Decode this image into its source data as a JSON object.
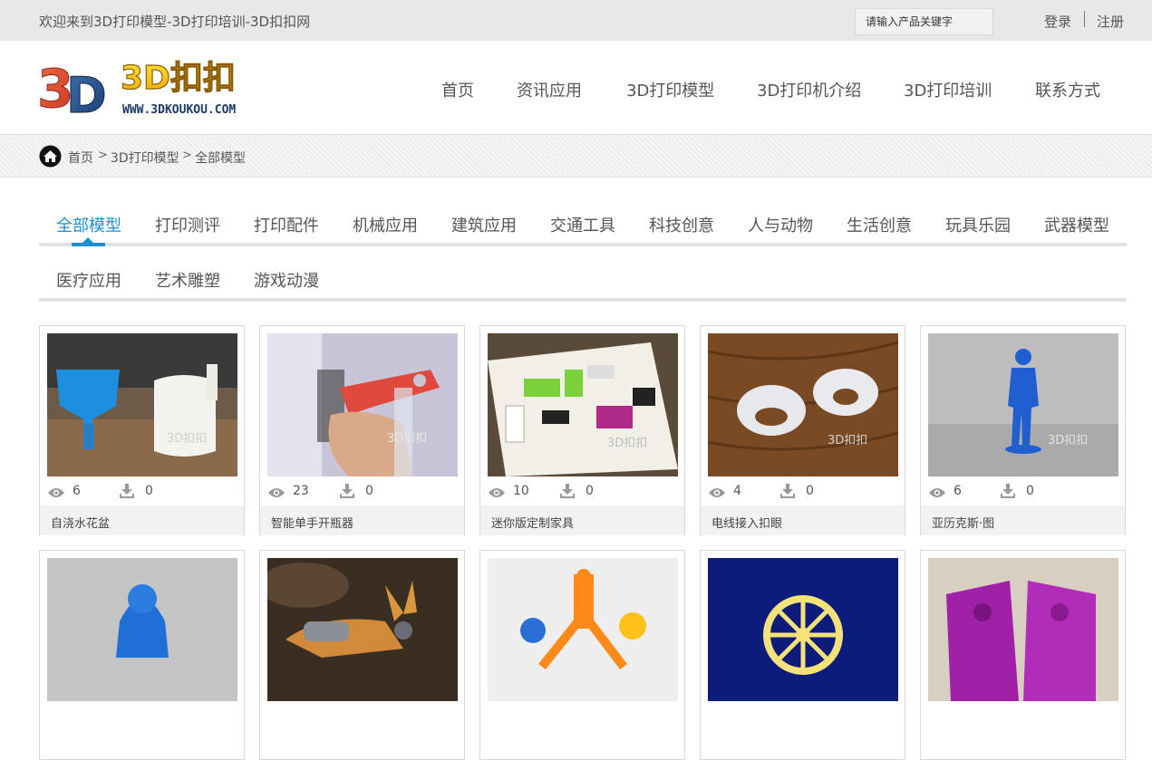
{
  "topbar": {
    "welcome": "欢迎来到3D打印模型-3D打印培训-3D扣扣网",
    "search_placeholder": "请输入产品关键字",
    "login": "登录",
    "register": "注册"
  },
  "logo": {
    "mark": "3D",
    "name": "3D扣扣",
    "url": "WWW.3DKOUKOU.COM"
  },
  "nav": [
    "首页",
    "资讯应用",
    "3D打印模型",
    "3D打印机介绍",
    "3D打印培训",
    "联系方式"
  ],
  "breadcrumb": {
    "items": [
      "首页",
      "3D打印模型",
      "全部模型"
    ],
    "separator": ">"
  },
  "categories": {
    "active": "全部模型",
    "row1": [
      "全部模型",
      "打印测评",
      "打印配件",
      "机械应用",
      "建筑应用",
      "交通工具",
      "科技创意",
      "人与动物",
      "生活创意",
      "玩具乐园",
      "武器模型"
    ],
    "row2": [
      "医疗应用",
      "艺术雕塑",
      "游戏动漫"
    ]
  },
  "accent_color": "#1f8fd1",
  "products": [
    {
      "title": "自浇水花盆",
      "views": "6",
      "downloads": "0",
      "watermark": "3D扣扣"
    },
    {
      "title": "智能单手开瓶器",
      "views": "23",
      "downloads": "0",
      "watermark": "3D扣扣"
    },
    {
      "title": "迷你版定制家具",
      "views": "10",
      "downloads": "0",
      "watermark": "3D扣扣"
    },
    {
      "title": "电线接入扣眼",
      "views": "4",
      "downloads": "0",
      "watermark": "3D扣扣"
    },
    {
      "title": "亚历克斯·图",
      "views": "6",
      "downloads": "0",
      "watermark": "3D扣扣"
    }
  ],
  "icons": {
    "views": "eye-icon",
    "downloads": "download-icon",
    "home": "home-icon"
  }
}
